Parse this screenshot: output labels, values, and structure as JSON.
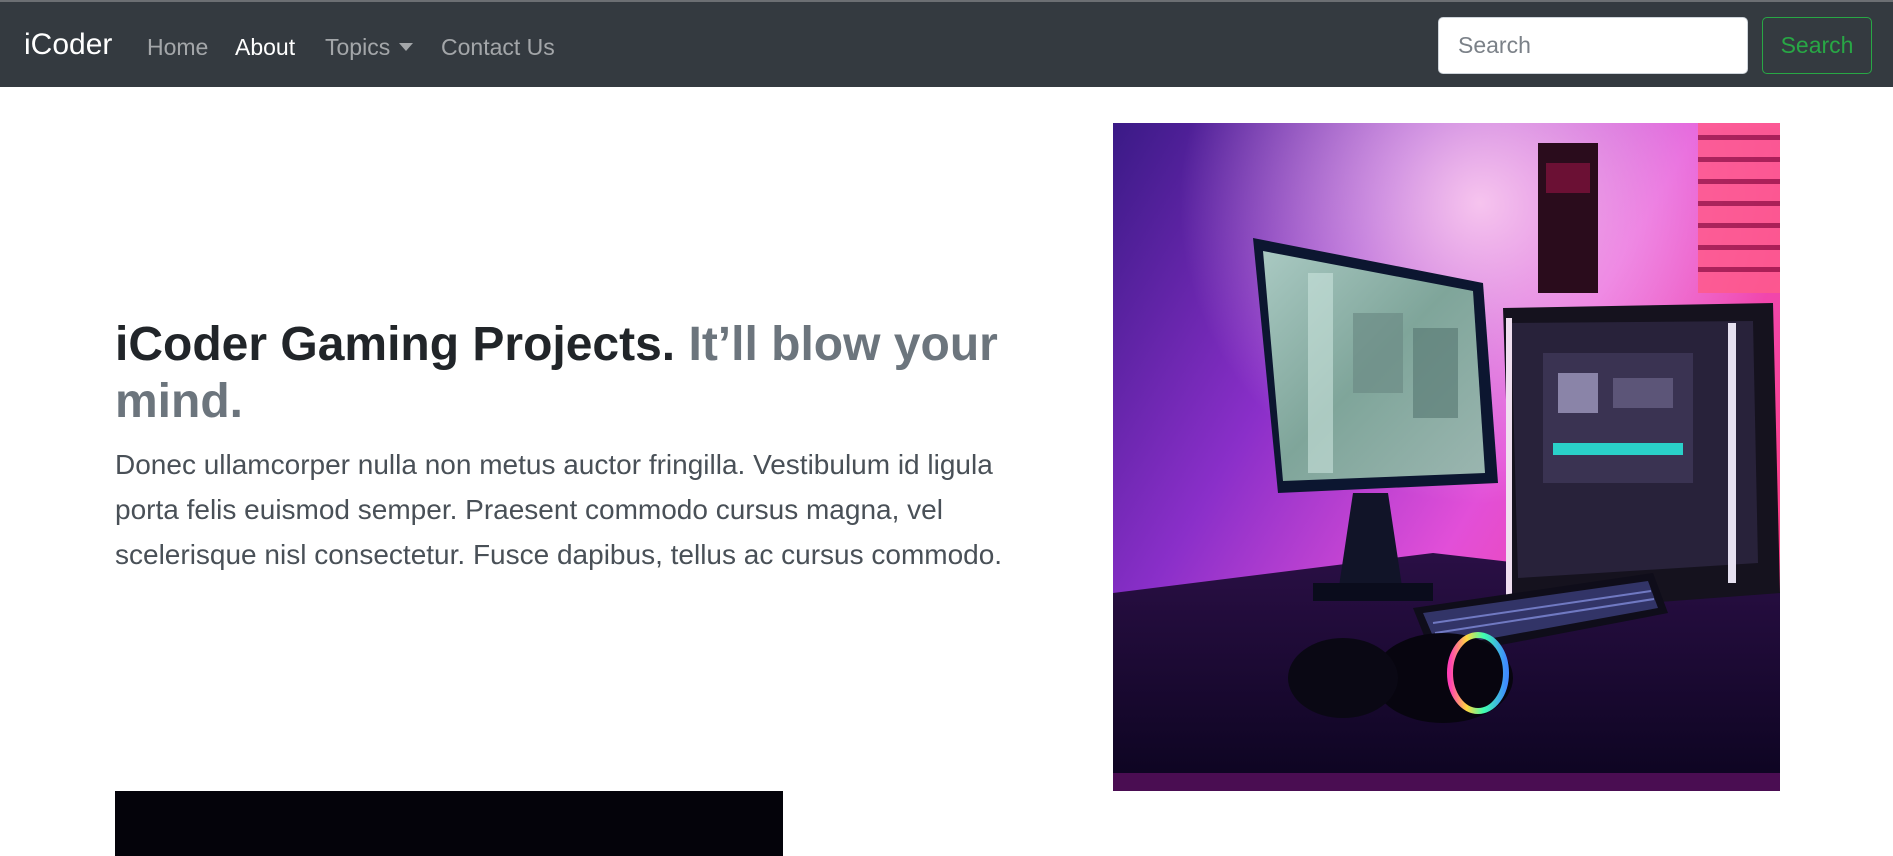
{
  "navbar": {
    "brand": "iCoder",
    "links": [
      {
        "label": "Home"
      },
      {
        "label": "About"
      },
      {
        "label": "Topics"
      },
      {
        "label": "Contact Us"
      }
    ],
    "search_placeholder": "Search",
    "search_button": "Search"
  },
  "hero": {
    "heading_main": "iCoder Gaming Projects.",
    "heading_muted": "It’ll blow your mind.",
    "lead": "Donec ullamcorper nulla non metus auctor fringilla. Vestibulum id ligula porta felis euismod semper. Praesent commodo cursus magna, vel scelerisque nisl consectetur. Fusce dapibus, tellus ac cursus commodo."
  },
  "colors": {
    "navbar_bg": "#343a40",
    "success": "#28a745",
    "muted_text": "#6c757d"
  },
  "icons": {
    "topics_dropdown": "caret-down-icon"
  }
}
